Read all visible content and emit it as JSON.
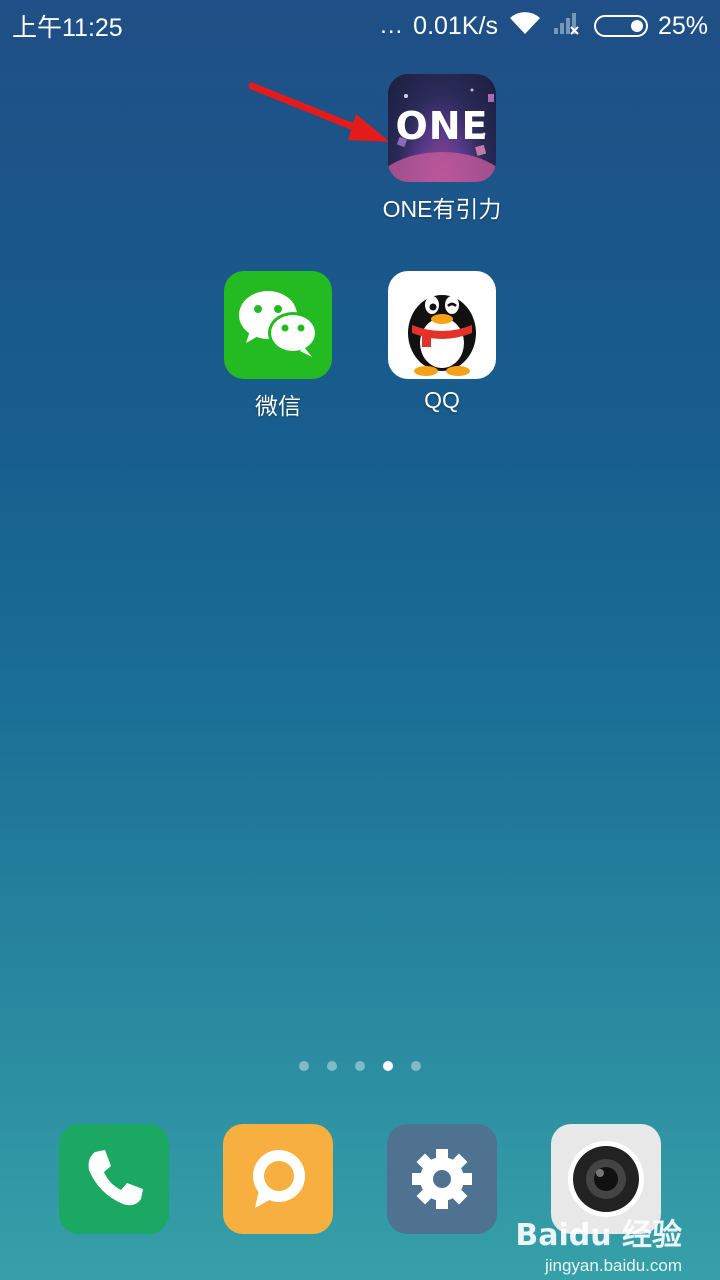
{
  "status_bar": {
    "time": "上午11:25",
    "dots": "...",
    "network_speed": "0.01K/s",
    "battery_percent": "25%"
  },
  "home_apps": [
    {
      "label": "ONE有引力",
      "icon": "one-app-icon",
      "icon_text": "ONE"
    },
    {
      "label": "微信",
      "icon": "wechat-icon"
    },
    {
      "label": "QQ",
      "icon": "qq-penguin-icon"
    }
  ],
  "page_indicator": {
    "count": 5,
    "active_index": 3
  },
  "dock": [
    {
      "icon": "phone-icon",
      "color": "#1aa863"
    },
    {
      "icon": "message-icon",
      "color": "#f7b040"
    },
    {
      "icon": "settings-gear-icon",
      "color": "#4f7290"
    },
    {
      "icon": "camera-icon",
      "color": "#e8e8e8"
    }
  ],
  "watermark": {
    "logo": "Baidu 经验",
    "url": "jingyan.baidu.com"
  },
  "colors": {
    "annotation_arrow": "#e41b1b"
  }
}
